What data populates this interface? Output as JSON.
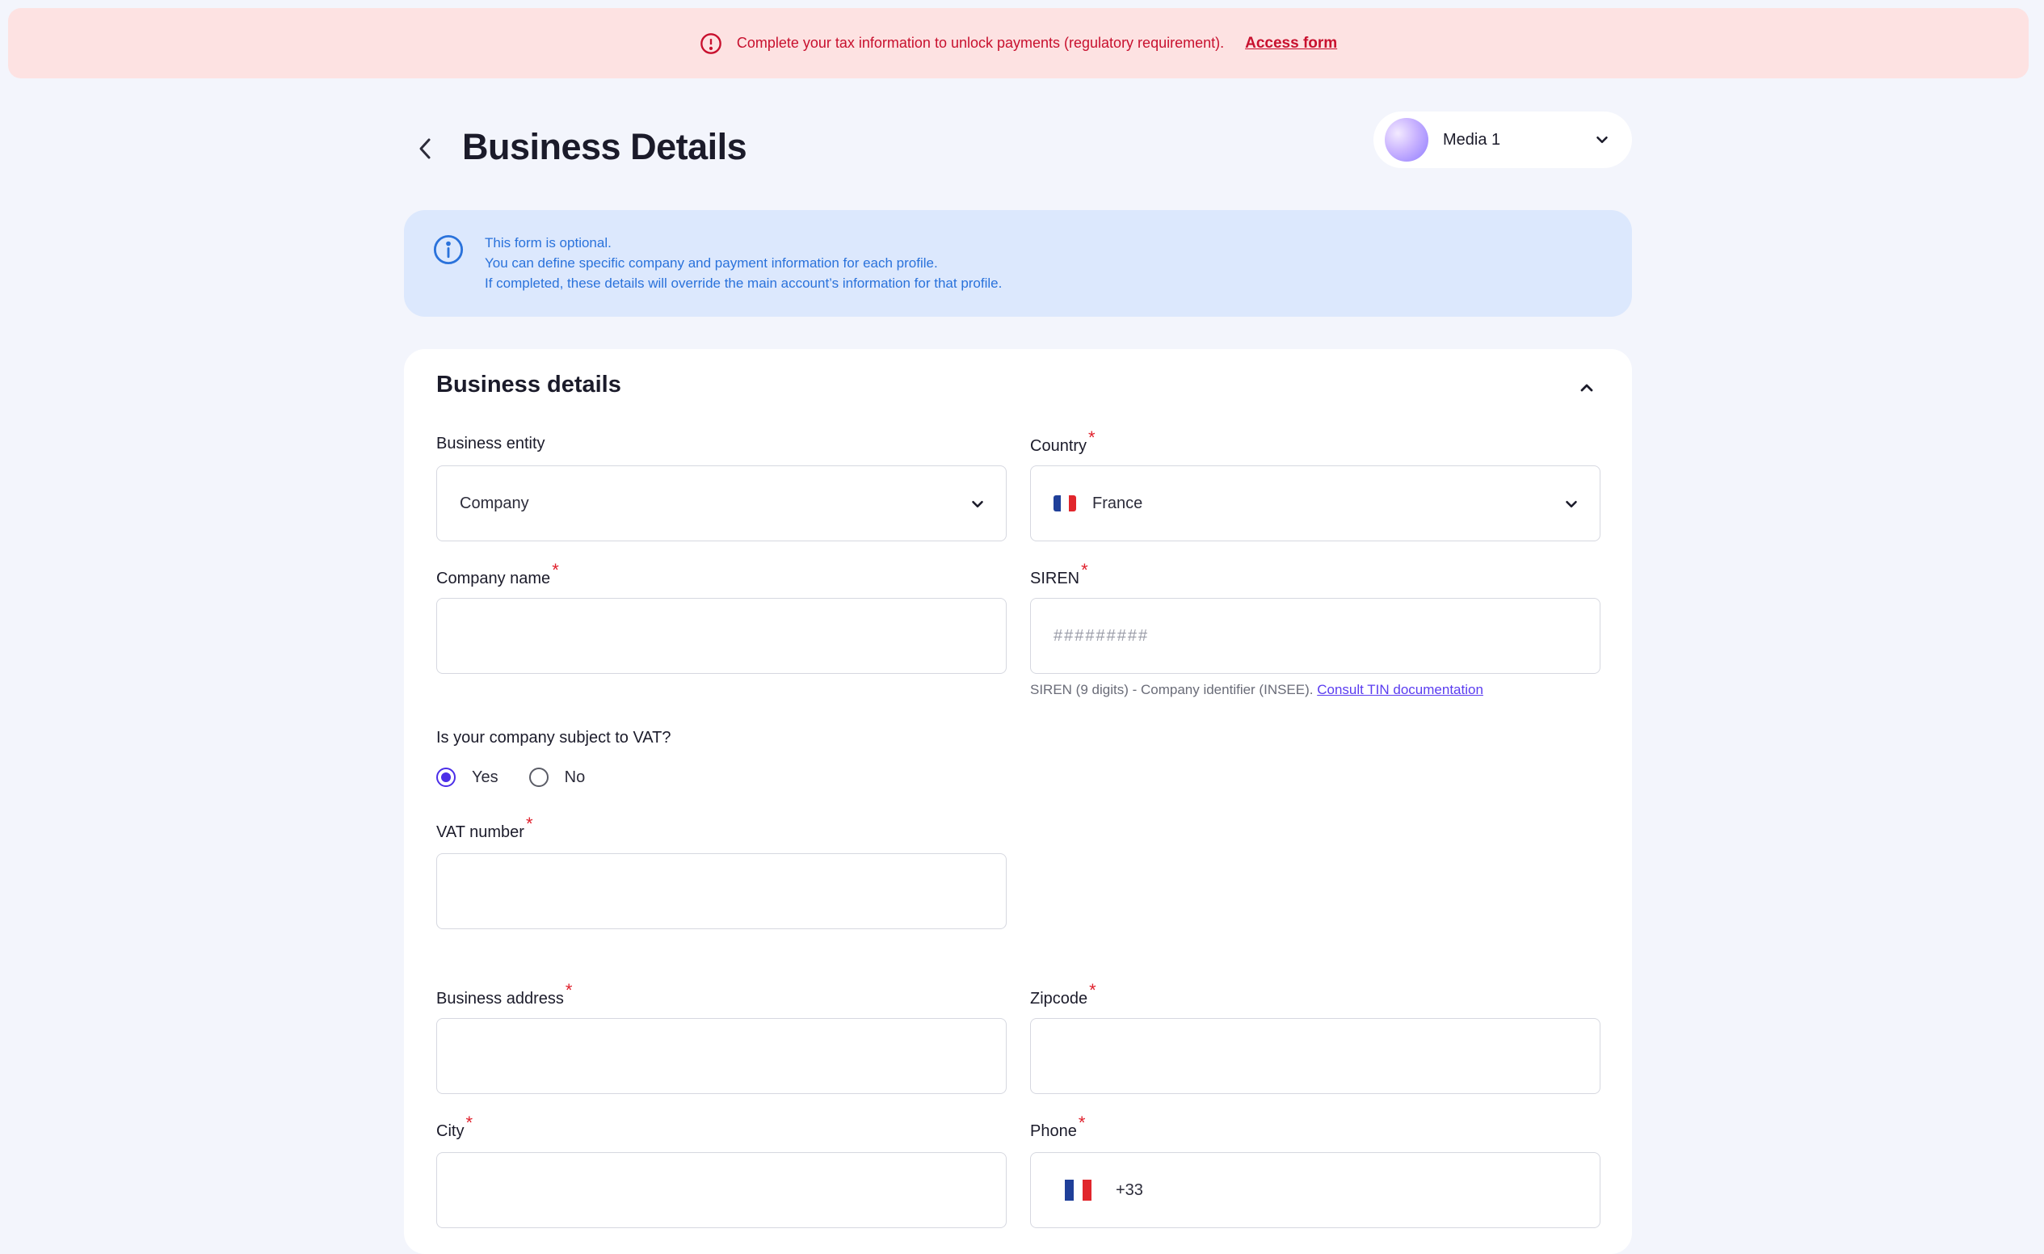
{
  "banner": {
    "message": "Complete your tax information to unlock payments (regulatory requirement).",
    "link_label": "Access form",
    "icon": "alert-circle-icon",
    "color": "#c8102e"
  },
  "header": {
    "title": "Business Details",
    "back_icon": "chevron-left-icon",
    "profile_name": "Media 1"
  },
  "info": {
    "line1": "This form is optional.",
    "line2": "You can define specific company and payment information for each profile.",
    "line3": "If completed, these details will override the main account’s information for that profile."
  },
  "section": {
    "title": "Business details"
  },
  "fields": {
    "business_entity": {
      "label": "Business entity",
      "value": "Company"
    },
    "country": {
      "label": "Country",
      "value": "France"
    },
    "company_name": {
      "label": "Company name",
      "value": ""
    },
    "siren": {
      "label": "SIREN",
      "placeholder": "#########",
      "helper": "SIREN (9 digits) - Company identifier (INSEE).",
      "helper_link": "Consult TIN documentation"
    },
    "vat_question": {
      "label": "Is your company subject to VAT?",
      "options": [
        "Yes",
        "No"
      ],
      "selected": "Yes"
    },
    "vat_number": {
      "label": "VAT number",
      "value": ""
    },
    "business_address": {
      "label": "Business address",
      "value": ""
    },
    "zipcode": {
      "label": "Zipcode",
      "value": ""
    },
    "city": {
      "label": "City",
      "value": ""
    },
    "phone": {
      "label": "Phone",
      "prefix": "+33",
      "value": ""
    }
  },
  "required_mark": "*",
  "colors": {
    "accent": "#4b2ee8",
    "required": "#e01f2b",
    "info": "#2a72db"
  }
}
